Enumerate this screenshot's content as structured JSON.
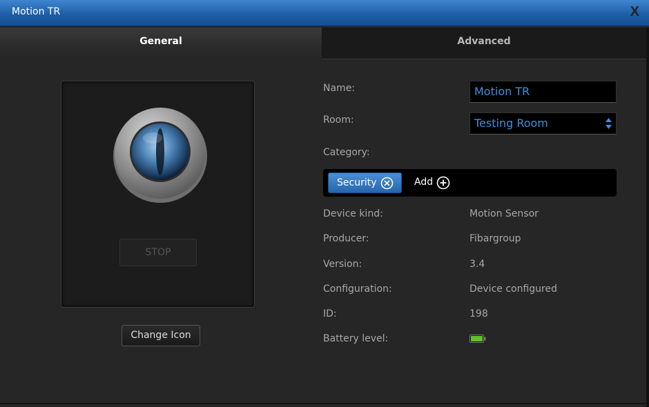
{
  "window": {
    "title": "Motion TR",
    "close_label": "X"
  },
  "tabs": [
    {
      "label": "General",
      "active": true
    },
    {
      "label": "Advanced",
      "active": false
    }
  ],
  "icon_panel": {
    "stop_label": "STOP",
    "change_icon_label": "Change Icon"
  },
  "form": {
    "name_label": "Name:",
    "name_value": "Motion TR",
    "room_label": "Room:",
    "room_value": "Testing Room",
    "category_label": "Category:",
    "category_chip": "Security",
    "add_label": "Add"
  },
  "details": [
    {
      "label": "Device kind:",
      "value": "Motion Sensor"
    },
    {
      "label": "Producer:",
      "value": "Fibargroup"
    },
    {
      "label": "Version:",
      "value": "3.4"
    },
    {
      "label": "Configuration:",
      "value": "Device configured"
    },
    {
      "label": "ID:",
      "value": "198"
    },
    {
      "label": "Battery level:",
      "value": ""
    }
  ],
  "colors": {
    "titlebar": "#1f5fa8",
    "accent_text": "#3f8fdc",
    "chip": "#2f74c0",
    "battery": "#5fc224"
  },
  "icons": {
    "close": "close-icon",
    "sensor": "motion-sensor-icon",
    "room_arrows": "select-arrows-icon",
    "chip_remove": "remove-circle-icon",
    "add": "add-circle-icon",
    "battery": "battery-icon"
  },
  "battery_level": 1.0
}
